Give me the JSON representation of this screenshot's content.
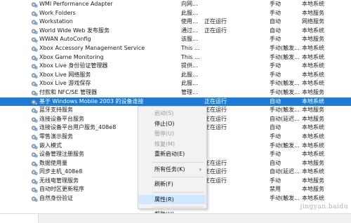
{
  "services": [
    {
      "name": "WMI Performance Adapter",
      "desc": "向网...",
      "status": "",
      "startup": "手动",
      "logon": "本地系统"
    },
    {
      "name": "Work Folders",
      "desc": "此服...",
      "status": "",
      "startup": "手动",
      "logon": "本地服务"
    },
    {
      "name": "Workstation",
      "desc": "使用...",
      "status": "正在运行",
      "startup": "自动",
      "logon": "网络服务"
    },
    {
      "name": "World Wide Web 发布服务",
      "desc": "通过...",
      "status": "正在运行",
      "startup": "自动",
      "logon": "本地系统"
    },
    {
      "name": "WWAN AutoConfig",
      "desc": "该服...",
      "status": "",
      "startup": "手动",
      "logon": "本地服务"
    },
    {
      "name": "Xbox Accessory Management Service",
      "desc": "This ...",
      "status": "",
      "startup": "手动(触发...",
      "logon": "本地系统"
    },
    {
      "name": "Xbox Game Monitoring",
      "desc": "This ...",
      "status": "",
      "startup": "手动(触发...",
      "logon": "本地系统"
    },
    {
      "name": "Xbox Live 身份验证管理器",
      "desc": "提供...",
      "status": "",
      "startup": "手动",
      "logon": "本地系统"
    },
    {
      "name": "Xbox Live 网络服务",
      "desc": "此服...",
      "status": "",
      "startup": "手动",
      "logon": "本地系统"
    },
    {
      "name": "Xbox Live 游戏保存",
      "desc": "此服...",
      "status": "",
      "startup": "手动(触发...",
      "logon": "本地系统"
    },
    {
      "name": "付款和 NFC/SE 管理器",
      "desc": "管理...",
      "status": "",
      "startup": "手动(触发...",
      "logon": "本地服务"
    },
    {
      "name": "基于 Windows Mobile 2003 的设备连接",
      "desc": "",
      "status": "正在运行",
      "startup": "自动",
      "logon": "本地系统",
      "selected": true
    },
    {
      "name": "蓝牙支持服务",
      "desc": "",
      "status": "正在运行",
      "startup": "手动(触发...",
      "logon": "本地服务"
    },
    {
      "name": "连接设备平台服务",
      "desc": "",
      "status": "正在运行",
      "startup": "自动(延迟...",
      "logon": "本地服务"
    },
    {
      "name": "连接设备平台用户服务_408e8",
      "desc": "",
      "status": "正在运行",
      "startup": "自动",
      "logon": "本地系统"
    },
    {
      "name": "零售演示服务",
      "desc": "",
      "status": "",
      "startup": "手动",
      "logon": "本地系统"
    },
    {
      "name": "嵌入模式",
      "desc": "",
      "status": "",
      "startup": "手动(触发...",
      "logon": "本地系统"
    },
    {
      "name": "设备管理注册服务",
      "desc": "",
      "status": "",
      "startup": "手动",
      "logon": "本地系统"
    },
    {
      "name": "数据使用量",
      "desc": "",
      "status": "正在运行",
      "startup": "自动",
      "logon": "本地服务"
    },
    {
      "name": "同步主机_408e8",
      "desc": "",
      "status": "正在运行",
      "startup": "自动(延迟...",
      "logon": "本地系统"
    },
    {
      "name": "无线电管理服务",
      "desc": "",
      "status": "正在运行",
      "startup": "手动",
      "logon": "本地服务"
    },
    {
      "name": "自动时区更新程序",
      "desc": "",
      "status": "",
      "startup": "禁用",
      "logon": "本地服务"
    },
    {
      "name": "自然身份验证",
      "desc": "",
      "status": "",
      "startup": "手动(触发...",
      "logon": "本地系统"
    }
  ],
  "context_menu": [
    {
      "label": "启动(S)",
      "disabled": true
    },
    {
      "label": "停止(O)",
      "disabled": false
    },
    {
      "label": "暂停(U)",
      "disabled": true
    },
    {
      "label": "恢复(M)",
      "disabled": true
    },
    {
      "label": "重新启动(E)",
      "disabled": false
    },
    {
      "sep": true
    },
    {
      "label": "所有任务(K)",
      "disabled": false,
      "submenu": true
    },
    {
      "sep": true
    },
    {
      "label": "刷新(F)",
      "disabled": false
    },
    {
      "sep": true
    },
    {
      "label": "属性(R)",
      "disabled": false,
      "hover": true
    },
    {
      "sep": true
    },
    {
      "label": "帮助(H)",
      "disabled": false
    }
  ],
  "watermark": "jingyan.baidu",
  "colors": {
    "selection": "#1c7bd6",
    "menu_hover": "#cde8ff"
  }
}
